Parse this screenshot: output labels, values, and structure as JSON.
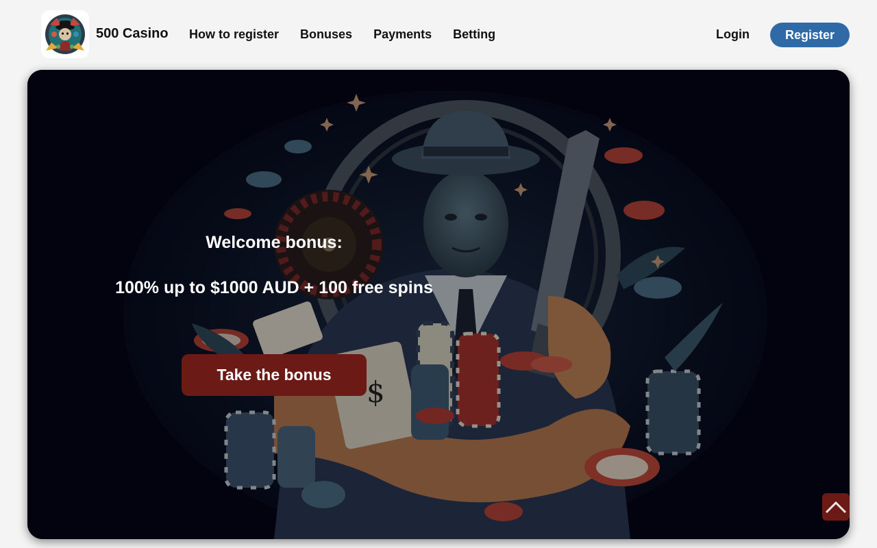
{
  "header": {
    "brand": "500 Casino",
    "nav": [
      {
        "label": "How to register"
      },
      {
        "label": "Bonuses"
      },
      {
        "label": "Payments"
      },
      {
        "label": "Betting"
      }
    ],
    "login_label": "Login",
    "register_label": "Register"
  },
  "hero": {
    "welcome_text": "Welcome bonus:",
    "offer_text": "100% up to $1000 AUD + 100 free spins",
    "cta_label": "Take the bonus"
  },
  "icons": {
    "logo": "casino-logo-icon",
    "scroll_top": "chevron-up-icon"
  },
  "colors": {
    "page_bg": "#f4f4f4",
    "register_button": "#2f6aa6",
    "cta_button": "#6b1a16",
    "hero_bg": "#05061a"
  }
}
